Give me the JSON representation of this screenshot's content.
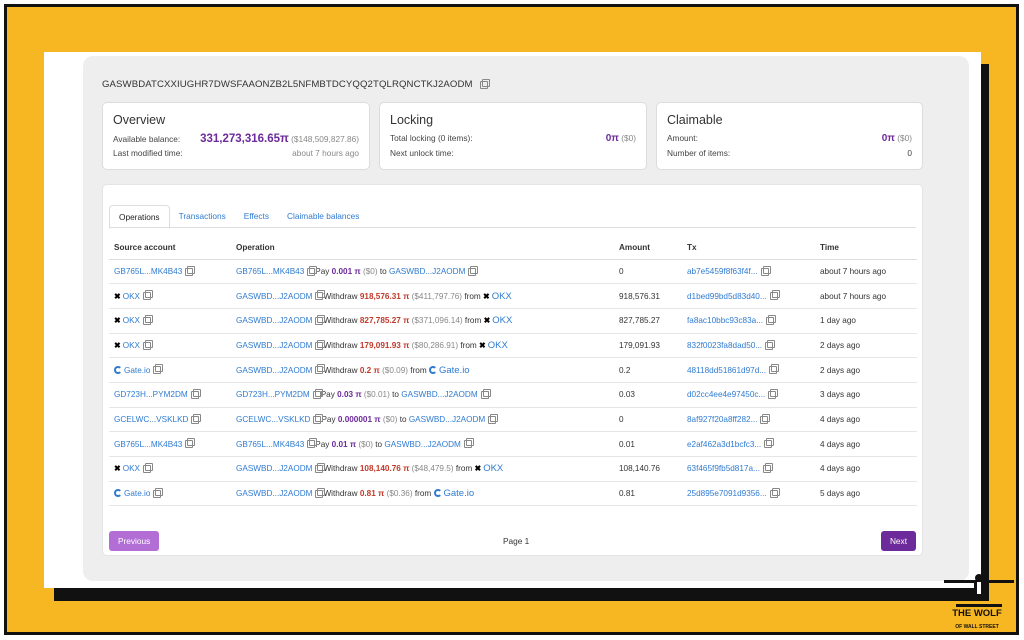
{
  "address": "GASWBDATCXXIUGHR7DWSFAAONZB2L5NFMBTDCYQQ2TQLRQNCTKJ2AODM",
  "overview": {
    "title": "Overview",
    "balance_label": "Available balance:",
    "balance_value": "331,273,316.65π",
    "balance_usd": "($148,509,827.86)",
    "modified_label": "Last modified time:",
    "modified_value": "about 7 hours ago"
  },
  "locking": {
    "title": "Locking",
    "total_label": "Total locking (0 items):",
    "total_value": "0π",
    "total_usd": "($0)",
    "unlock_label": "Next unlock time:"
  },
  "claimable": {
    "title": "Claimable",
    "amount_label": "Amount:",
    "amount_value": "0π",
    "amount_usd": "($0)",
    "items_label": "Number of items:",
    "items_value": "0"
  },
  "tabs": [
    "Operations",
    "Transactions",
    "Effects",
    "Claimable balances"
  ],
  "columns": [
    "Source account",
    "Operation",
    "Amount",
    "Tx",
    "Time"
  ],
  "rows": [
    {
      "src": "GB765L...MK4B43",
      "src_type": "account",
      "op_from": "GB765L...MK4B43",
      "op_kind": "Pay",
      "op_amount": "0.001 π",
      "op_amount_color": "purple",
      "op_usd": "($0)",
      "op_conn": "to",
      "op_target": "GASWBD...J2AODM",
      "op_target_type": "account",
      "amount": "0",
      "tx": "ab7e5459f8f63f4f...",
      "time": "about 7 hours ago"
    },
    {
      "src": "OKX",
      "src_type": "okx",
      "op_from": "GASWBD...J2AODM",
      "op_kind": "Withdraw",
      "op_amount": "918,576.31 π",
      "op_amount_color": "red",
      "op_usd": "($411,797.76)",
      "op_conn": "from",
      "op_target": "OKX",
      "op_target_type": "okx",
      "amount": "918,576.31",
      "tx": "d1bed99bd5d83d40...",
      "time": "about 7 hours ago"
    },
    {
      "src": "OKX",
      "src_type": "okx",
      "op_from": "GASWBD...J2AODM",
      "op_kind": "Withdraw",
      "op_amount": "827,785.27 π",
      "op_amount_color": "red",
      "op_usd": "($371,096.14)",
      "op_conn": "from",
      "op_target": "OKX",
      "op_target_type": "okx",
      "amount": "827,785.27",
      "tx": "fa8ac10bbc93c83a...",
      "time": "1 day ago"
    },
    {
      "src": "OKX",
      "src_type": "okx",
      "op_from": "GASWBD...J2AODM",
      "op_kind": "Withdraw",
      "op_amount": "179,091.93 π",
      "op_amount_color": "red",
      "op_usd": "($80,286.91)",
      "op_conn": "from",
      "op_target": "OKX",
      "op_target_type": "okx",
      "amount": "179,091.93",
      "tx": "832f0023fa8dad50...",
      "time": "2 days ago"
    },
    {
      "src": "Gate.io",
      "src_type": "gate",
      "op_from": "GASWBD...J2AODM",
      "op_kind": "Withdraw",
      "op_amount": "0.2 π",
      "op_amount_color": "red",
      "op_usd": "($0.09)",
      "op_conn": "from",
      "op_target": "Gate.io",
      "op_target_type": "gate",
      "amount": "0.2",
      "tx": "48118dd51861d97d...",
      "time": "2 days ago"
    },
    {
      "src": "GD723H...PYM2DM",
      "src_type": "account",
      "op_from": "GD723H...PYM2DM",
      "op_kind": "Pay",
      "op_amount": "0.03 π",
      "op_amount_color": "purple",
      "op_usd": "($0.01)",
      "op_conn": "to",
      "op_target": "GASWBD...J2AODM",
      "op_target_type": "account",
      "amount": "0.03",
      "tx": "d02cc4ee4e97450c...",
      "time": "3 days ago"
    },
    {
      "src": "GCELWC...VSKLKD",
      "src_type": "account",
      "op_from": "GCELWC...VSKLKD",
      "op_kind": "Pay",
      "op_amount": "0.000001 π",
      "op_amount_color": "purple",
      "op_usd": "($0)",
      "op_conn": "to",
      "op_target": "GASWBD...J2AODM",
      "op_target_type": "account",
      "amount": "0",
      "tx": "8af927f20a8ff282...",
      "time": "4 days ago"
    },
    {
      "src": "GB765L...MK4B43",
      "src_type": "account",
      "op_from": "GB765L...MK4B43",
      "op_kind": "Pay",
      "op_amount": "0.01 π",
      "op_amount_color": "purple",
      "op_usd": "($0)",
      "op_conn": "to",
      "op_target": "GASWBD...J2AODM",
      "op_target_type": "account",
      "amount": "0.01",
      "tx": "e2af462a3d1bcfc3...",
      "time": "4 days ago"
    },
    {
      "src": "OKX",
      "src_type": "okx",
      "op_from": "GASWBD...J2AODM",
      "op_kind": "Withdraw",
      "op_amount": "108,140.76 π",
      "op_amount_color": "red",
      "op_usd": "($48,479.5)",
      "op_conn": "from",
      "op_target": "OKX",
      "op_target_type": "okx",
      "amount": "108,140.76",
      "tx": "63f465f9fb5d817a...",
      "time": "4 days ago"
    },
    {
      "src": "Gate.io",
      "src_type": "gate",
      "op_from": "GASWBD...J2AODM",
      "op_kind": "Withdraw",
      "op_amount": "0.81 π",
      "op_amount_color": "red",
      "op_usd": "($0.36)",
      "op_conn": "from",
      "op_target": "Gate.io",
      "op_target_type": "gate",
      "amount": "0.81",
      "tx": "25d895e7091d9356...",
      "time": "5 days ago"
    }
  ],
  "pagination": {
    "previous": "Previous",
    "page": "Page 1",
    "next": "Next"
  },
  "logo": {
    "title": "THE WOLF",
    "subtitle": "OF WALL STREET"
  },
  "colors": {
    "frame": "#f7b722",
    "purple": "#6c2a9a",
    "link": "#2f7bd1",
    "withdraw": "#c0392b"
  }
}
